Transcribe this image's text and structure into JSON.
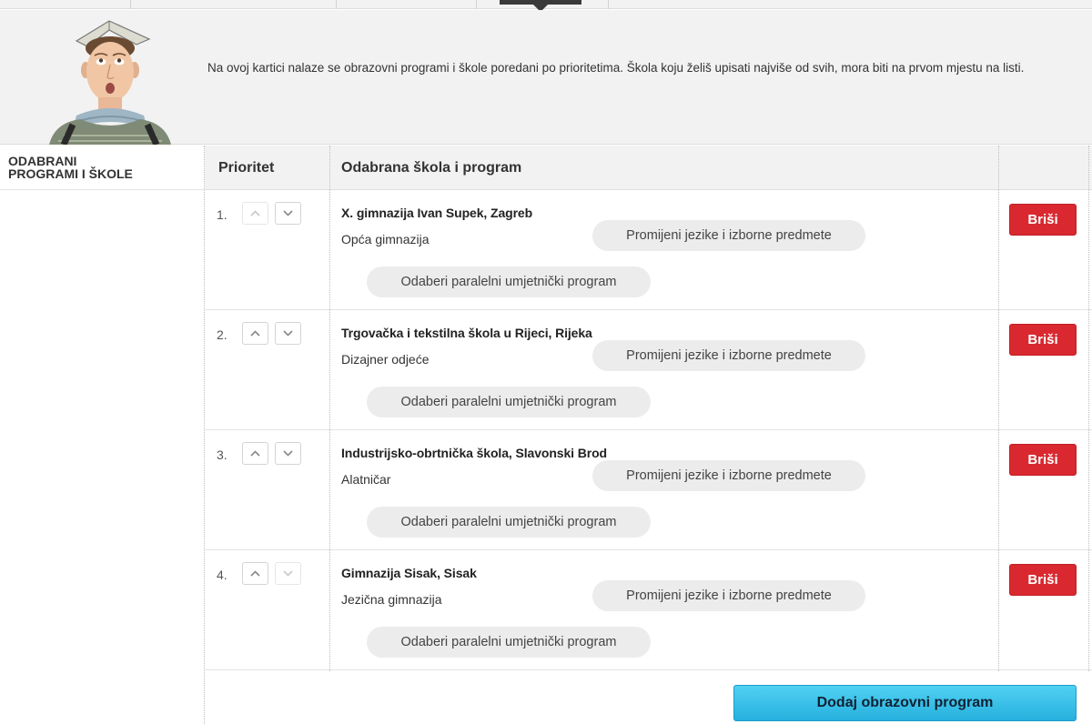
{
  "banner": {
    "text": "Na ovoj kartici nalaze se obrazovni programi i škole poredani po prioritetima. Škola koju želiš upisati najviše od svih, mora biti na prvom mjestu na listi."
  },
  "side": {
    "label": "ODABRANI\nPROGRAMI I ŠKOLE"
  },
  "table": {
    "headers": {
      "priority": "Prioritet",
      "school": "Odabrana škola i program"
    },
    "rows": [
      {
        "num": "1.",
        "school": "X. gimnazija Ivan Supek, Zagreb",
        "program": "Opća gimnazija",
        "up_disabled": true,
        "down_disabled": false
      },
      {
        "num": "2.",
        "school": "Trgovačka i tekstilna škola u Rijeci, Rijeka",
        "program": "Dizajner odjeće",
        "up_disabled": false,
        "down_disabled": false
      },
      {
        "num": "3.",
        "school": "Industrijsko-obrtnička škola, Slavonski Brod",
        "program": "Alatničar",
        "up_disabled": false,
        "down_disabled": false
      },
      {
        "num": "4.",
        "school": "Gimnazija Sisak, Sisak",
        "program": "Jezična gimnazija",
        "up_disabled": false,
        "down_disabled": true
      }
    ],
    "lang_button": "Promijeni jezike i izborne predmete",
    "art_button": "Odaberi paralelni umjetnički program",
    "delete_button": "Briši"
  },
  "footer": {
    "add_button": "Dodaj obrazovni program"
  },
  "colors": {
    "delete": "#d9282f",
    "add": "#36bfe6",
    "pill": "#ececec",
    "banner": "#f2f2f2"
  },
  "icons": [
    "chevron-up-icon",
    "chevron-down-icon"
  ]
}
